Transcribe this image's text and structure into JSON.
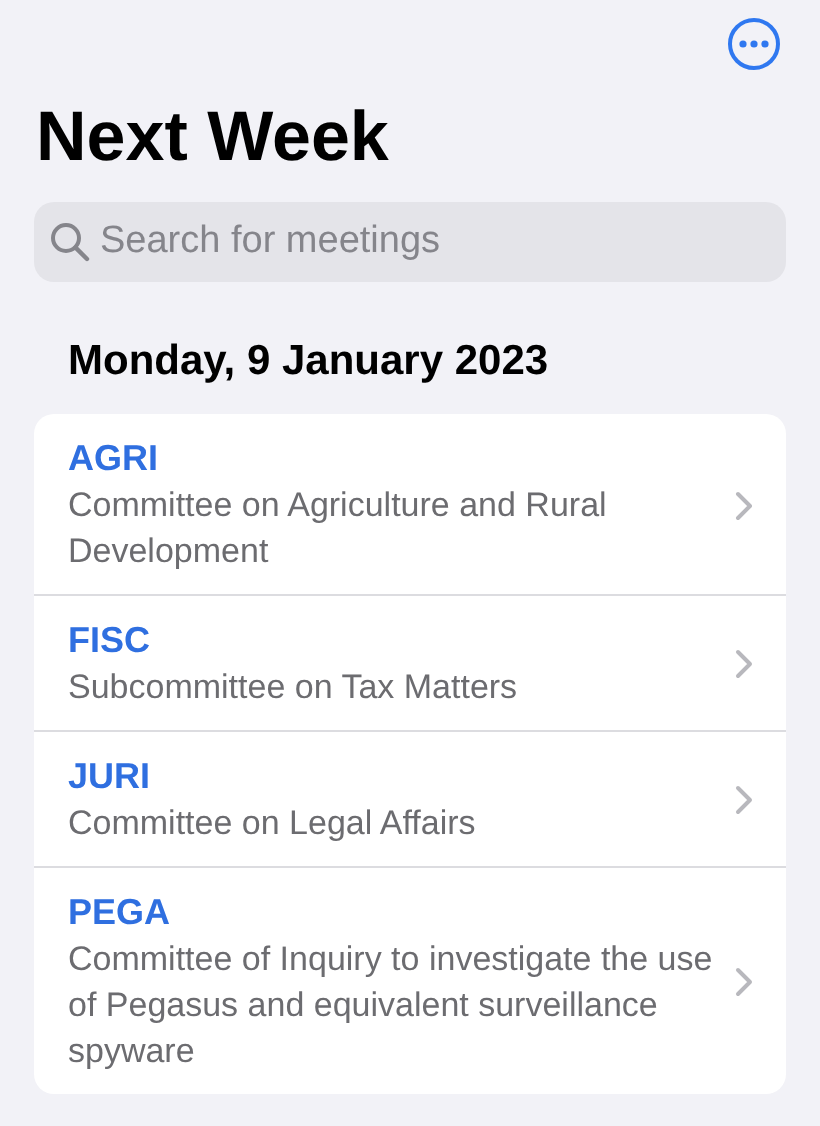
{
  "title": "Next Week",
  "search": {
    "placeholder": "Search for meetings"
  },
  "date_header": "Monday, 9 January 2023",
  "meetings": [
    {
      "code": "AGRI",
      "name": "Committee on Agriculture and Rural Development"
    },
    {
      "code": "FISC",
      "name": "Subcommittee on Tax Matters"
    },
    {
      "code": "JURI",
      "name": "Committee on Legal Affairs"
    },
    {
      "code": "PEGA",
      "name": "Committee of Inquiry to investigate the use of Pegasus and equivalent surveillance spyware"
    }
  ]
}
